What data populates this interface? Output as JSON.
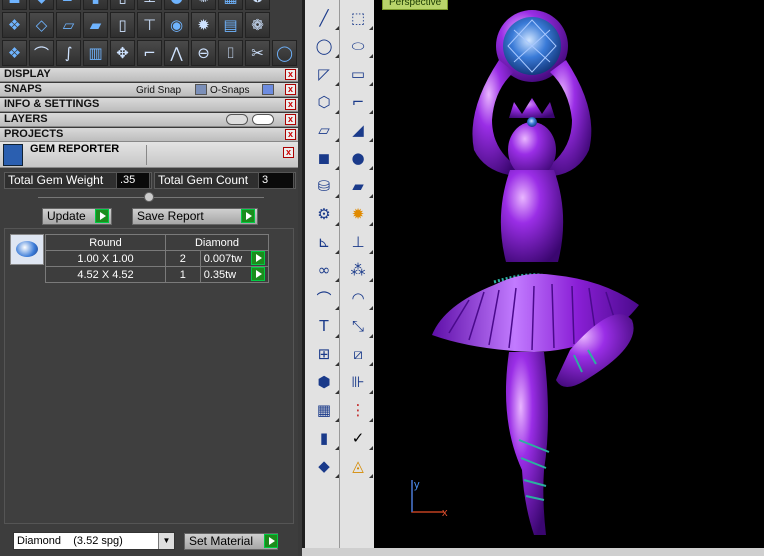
{
  "toolbar": {
    "row1": [
      "cube-icon",
      "diamond-icon",
      "parallelogram-icon",
      "sheet-icon",
      "doc-icon",
      "stand-icon",
      "orb-icon",
      "sparkle-icon",
      "grid-icon",
      "rings-icon"
    ],
    "row2": [
      "cubes-icon",
      "arc-icon",
      "curve-icon",
      "slice-icon",
      "move-icon",
      "bracket-icon",
      "spikes-icon",
      "link-icon",
      "split-icon",
      "scissors-icon",
      "ring-icon"
    ]
  },
  "panels": {
    "display": "DISPLAY",
    "snaps": "SNAPS",
    "grid_snap": "Grid Snap",
    "o_snaps": "O-Snaps",
    "info_settings": "INFO & SETTINGS",
    "layers": "LAYERS",
    "projects": "PROJECTS",
    "close": "x"
  },
  "gem_reporter": {
    "title": "GEM REPORTER",
    "total_weight_label": "Total Gem Weight",
    "total_weight_value": ".35",
    "total_count_label": "Total Gem Count",
    "total_count_value": "3",
    "update_label": "Update",
    "save_report_label": "Save Report",
    "table": {
      "headers": [
        "Round",
        "Diamond"
      ],
      "rows": [
        {
          "size": "1.00 X 1.00",
          "qty": "2",
          "weight": "0.007tw"
        },
        {
          "size": "4.52 X 4.52",
          "qty": "1",
          "weight": "0.35tw"
        }
      ]
    }
  },
  "material": {
    "selected": "Diamond    (3.52 spg)",
    "set_label": "Set Material"
  },
  "viewport": {
    "tab": "Perspective",
    "axis_y": "y",
    "axis_x": "x"
  },
  "colors": {
    "figure": "#8a1fd6",
    "gem": "#3a7bd8",
    "accent_green": "#1c8c1c"
  }
}
